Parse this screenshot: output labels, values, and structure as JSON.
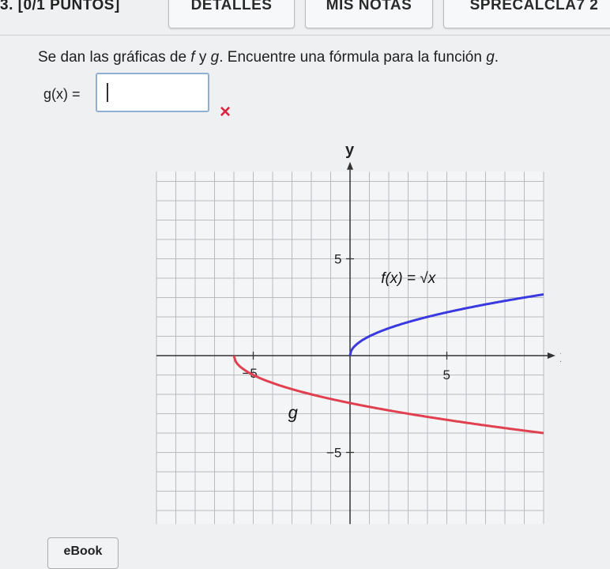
{
  "question": {
    "number_label": "3. [0/1 PUNTOS]"
  },
  "tabs": [
    {
      "label": "DETALLES"
    },
    {
      "label": "MIS NOTAS"
    },
    {
      "label": "SPRECALCLA7 2"
    }
  ],
  "prompt": {
    "before": "Se dan las gráficas de ",
    "f": "f",
    "y": " y ",
    "g": "g",
    "after": ". Encuentre una fórmula para la función ",
    "g2": "g",
    "end": "."
  },
  "answer": {
    "label": "g(x) =",
    "value": "",
    "status": "incorrect",
    "status_icon": "×"
  },
  "graph": {
    "y_axis_label": "y",
    "x_axis_label": "x",
    "tick_5": "5",
    "tick_neg5_x": "−5",
    "tick_neg5_y": "−5",
    "f_label": "f(x) = √x",
    "g_label": "g",
    "x_range": [
      -10,
      10
    ],
    "y_range": [
      -8,
      9
    ],
    "f_color": "#3a3ae0",
    "g_color": "#e0404f"
  },
  "footer": {
    "ebook_label": "eBook"
  }
}
